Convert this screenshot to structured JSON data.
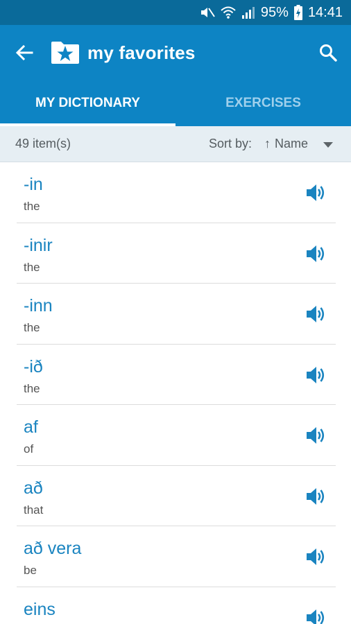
{
  "status_bar": {
    "battery_percent": "95%",
    "time": "14:41"
  },
  "app_bar": {
    "title": "my favorites",
    "back_icon": "arrow-left-icon",
    "folder_icon": "star-folder-icon",
    "search_icon": "search-icon"
  },
  "tabs": [
    {
      "label": "MY DICTIONARY",
      "active": true
    },
    {
      "label": "EXERCISES",
      "active": false
    }
  ],
  "sort_bar": {
    "count": "49 item(s)",
    "sort_label": "Sort by:",
    "sort_arrow": "↑",
    "sort_value": "Name"
  },
  "entries": [
    {
      "word": "-in",
      "gloss": "the"
    },
    {
      "word": "-inir",
      "gloss": "the"
    },
    {
      "word": "-inn",
      "gloss": "the"
    },
    {
      "word": "-ið",
      "gloss": "the"
    },
    {
      "word": "af",
      "gloss": "of"
    },
    {
      "word": "að",
      "gloss": "that"
    },
    {
      "word": "að vera",
      "gloss": "be"
    },
    {
      "word": "eins",
      "gloss": ""
    }
  ],
  "colors": {
    "status_bar": "#0a6a9a",
    "primary": "#0d84c4",
    "accent_text": "#1a84c0",
    "sort_bar_bg": "#e6eef3"
  }
}
